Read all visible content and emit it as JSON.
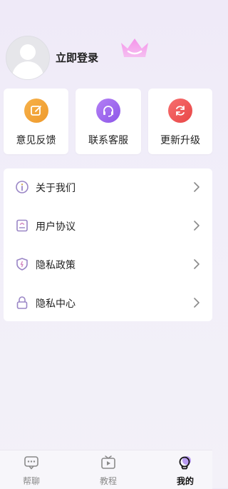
{
  "profile": {
    "login_label": "立即登录",
    "avatar_icon": "user-avatar-icon",
    "crown_icon": "crown-icon"
  },
  "actions": [
    {
      "label": "意见反馈",
      "icon": "edit-icon",
      "color": "#f2a53a"
    },
    {
      "label": "联系客服",
      "icon": "headset-icon",
      "color": "#9b66ee"
    },
    {
      "label": "更新升级",
      "icon": "refresh-icon",
      "color": "#ef5656"
    }
  ],
  "menu": [
    {
      "label": "关于我们",
      "icon": "info-icon"
    },
    {
      "label": "用户协议",
      "icon": "document-icon"
    },
    {
      "label": "隐私政策",
      "icon": "shield-icon"
    },
    {
      "label": "隐私中心",
      "icon": "lock-icon"
    }
  ],
  "nav": [
    {
      "label": "帮聊",
      "icon": "chat-bubble-icon",
      "active": false
    },
    {
      "label": "教程",
      "icon": "video-tv-icon",
      "active": false
    },
    {
      "label": "我的",
      "icon": "profile-icon",
      "active": true
    }
  ],
  "colors": {
    "accent": "#8d5fe0",
    "background": "#f1eef9",
    "icon_line": "#9a86c6"
  }
}
